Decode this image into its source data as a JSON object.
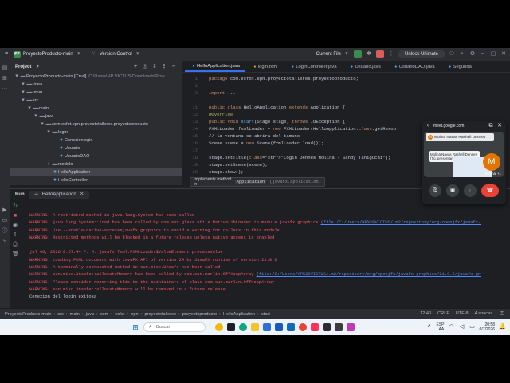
{
  "topbar": {
    "project_badge": "PP",
    "project_name": "ProyectoProducto-main",
    "vcs_label": "Version Control",
    "run_config": "Current File",
    "unlock_label": "Unlock Ultimate"
  },
  "project_panel": {
    "title": "Project",
    "rows": [
      {
        "label": "ProyectoProducto-main [Crud]",
        "extra": "C:\\Users\\HP VICTUS\\Downloads\\Proy",
        "indent": 0
      },
      {
        "label": ".idea",
        "extra": "",
        "indent": 1
      },
      {
        "label": ".mvn",
        "extra": "",
        "indent": 1
      },
      {
        "label": "src",
        "extra": "",
        "indent": 1
      },
      {
        "label": "main",
        "extra": "",
        "indent": 2
      },
      {
        "label": "java",
        "extra": "",
        "indent": 3
      },
      {
        "label": "com.esfot.epn.proyectotalleres.proyectoproducto",
        "extra": "",
        "indent": 4
      },
      {
        "label": "login",
        "extra": "",
        "indent": 5
      },
      {
        "label": "Conexionlogin",
        "extra": "",
        "indent": 6
      },
      {
        "label": "Usuario",
        "extra": "",
        "indent": 6
      },
      {
        "label": "UsuarioDAO",
        "extra": "",
        "indent": 6
      },
      {
        "label": "modelo",
        "extra": "",
        "indent": 5
      },
      {
        "label": "HelloApplication",
        "extra": "",
        "indent": 5
      },
      {
        "label": "HelloController",
        "extra": "",
        "indent": 5
      }
    ]
  },
  "editor": {
    "tabs": [
      "HelloApplication.java",
      "login.fxml",
      "LoginController.java",
      "Usuario.java",
      "UsuarioDAO.java",
      "Segurida"
    ],
    "lines": [
      {
        "num": "1",
        "text": "package com.esfot.epn.proyectotalleres.proyectoproducto;"
      },
      {
        "num": "2",
        "text": ""
      },
      {
        "num": "3",
        "text": "import ..."
      },
      {
        "num": "",
        "text": ""
      },
      {
        "num": "11",
        "text": "public class HelloApplication extends Application {"
      },
      {
        "num": "12",
        "text": "    @Override"
      },
      {
        "num": "13",
        "text": "    public void start(Stage stage) throws IOException {"
      },
      {
        "num": "14",
        "text": "        FXMLLoader fxmlLoader = new FXMLLoader(HelloApplication.class.getResou"
      },
      {
        "num": "15",
        "text": "        // la ventana se abrira del tamano"
      },
      {
        "num": "16",
        "text": "        Scene scene = new Scene(fxmlLoader.load());"
      },
      {
        "num": "17",
        "text": ""
      },
      {
        "num": "18",
        "text": "        stage.setTitle(\"Login Dennes Molina - Sandy Taniguchi\");"
      },
      {
        "num": "19",
        "text": "        stage.setScene(scene);"
      },
      {
        "num": "20",
        "text": "        stage.show();"
      },
      {
        "num": "21",
        "text": "    }"
      }
    ],
    "tooltip_prefix": "Implements method in",
    "tooltip_class": "Application",
    "tooltip_pkg": "(javafx.application)"
  },
  "run_panel": {
    "label": "Run",
    "tab": "HelloApplication",
    "lines": [
      {
        "t": "WARNING: A restricted method in java.lang.System has been called",
        "c": "err",
        "link": ""
      },
      {
        "t": "WARNING: java.lang.System::load has been called by com.sun.glass.utils.NativeLibLoader in module javafx.graphics ",
        "c": "err",
        "link": "(file:/C:/Users/HP%20VICTUS/.m2/repository/org/openjfx/javafx-"
      },
      {
        "t": "WARNING: Use --enable-native-access=javafx.graphics to avoid a warning for callers in this module",
        "c": "err",
        "link": ""
      },
      {
        "t": "WARNING: Restricted methods will be blocked in a future release unless native access is enabled",
        "c": "err",
        "link": ""
      },
      {
        "t": "",
        "c": "norm",
        "link": ""
      },
      {
        "t": "jul 06, 2026 8:57:44 P. M. javafx.fxml.FXMLLoader$ValueElement processValue",
        "c": "err",
        "link": ""
      },
      {
        "t": "WARNING: Loading FXML document with JavaFX API of version 24 by JavaFX runtime of version 21.0.6",
        "c": "err",
        "link": ""
      },
      {
        "t": "WARNING: A terminally deprecated method in sun.misc.Unsafe has been called",
        "c": "err",
        "link": ""
      },
      {
        "t": "WARNING: sun.misc.Unsafe::allocateMemory has been called by com.sun.marlin.OffHeapArray ",
        "c": "err",
        "link": "(file:/C:/Users/HP%20VICTUS/.m2/repository/org/openjfx/javafx-graphics/21.0.6/javafx-gr"
      },
      {
        "t": "WARNING: Please consider reporting this to the maintainers of class com.sun.marlin.OffHeapArray",
        "c": "err",
        "link": ""
      },
      {
        "t": "WARNING: sun.misc.Unsafe::allocateMemory will be removed in a future release",
        "c": "err",
        "link": ""
      },
      {
        "t": "Conexion del login exitosa",
        "c": "norm",
        "link": ""
      }
    ]
  },
  "statusbar": {
    "crumbs": [
      "ProyectoProducto-main",
      "src",
      "main",
      "java",
      "com",
      "esfot",
      "epn",
      "proyectotalleres",
      "proyectoproducto",
      "HelloApplication",
      "start"
    ],
    "position": "12:43",
    "line_sep": "CRLF",
    "encoding": "UTF-8",
    "indent": "4 spaces"
  },
  "meet": {
    "url": "meet.google.com",
    "presenter_chip": "Molina Navas Rashell Dennes",
    "presenter_tooltip": "Molina Navas Rashell Dennes (Tú, presentando)",
    "avatar_letter": "M",
    "tile_name": "Molina",
    "tile_count": "+1"
  },
  "taskbar": {
    "search_placeholder": "Buscar",
    "lang": "ESP",
    "region": "LAA",
    "time": "20:58",
    "date": "6/7/2026"
  },
  "colors": {
    "accent": "#3574f0",
    "error_text": "#f75464",
    "link": "#548af7",
    "hangup": "#ea4335"
  }
}
